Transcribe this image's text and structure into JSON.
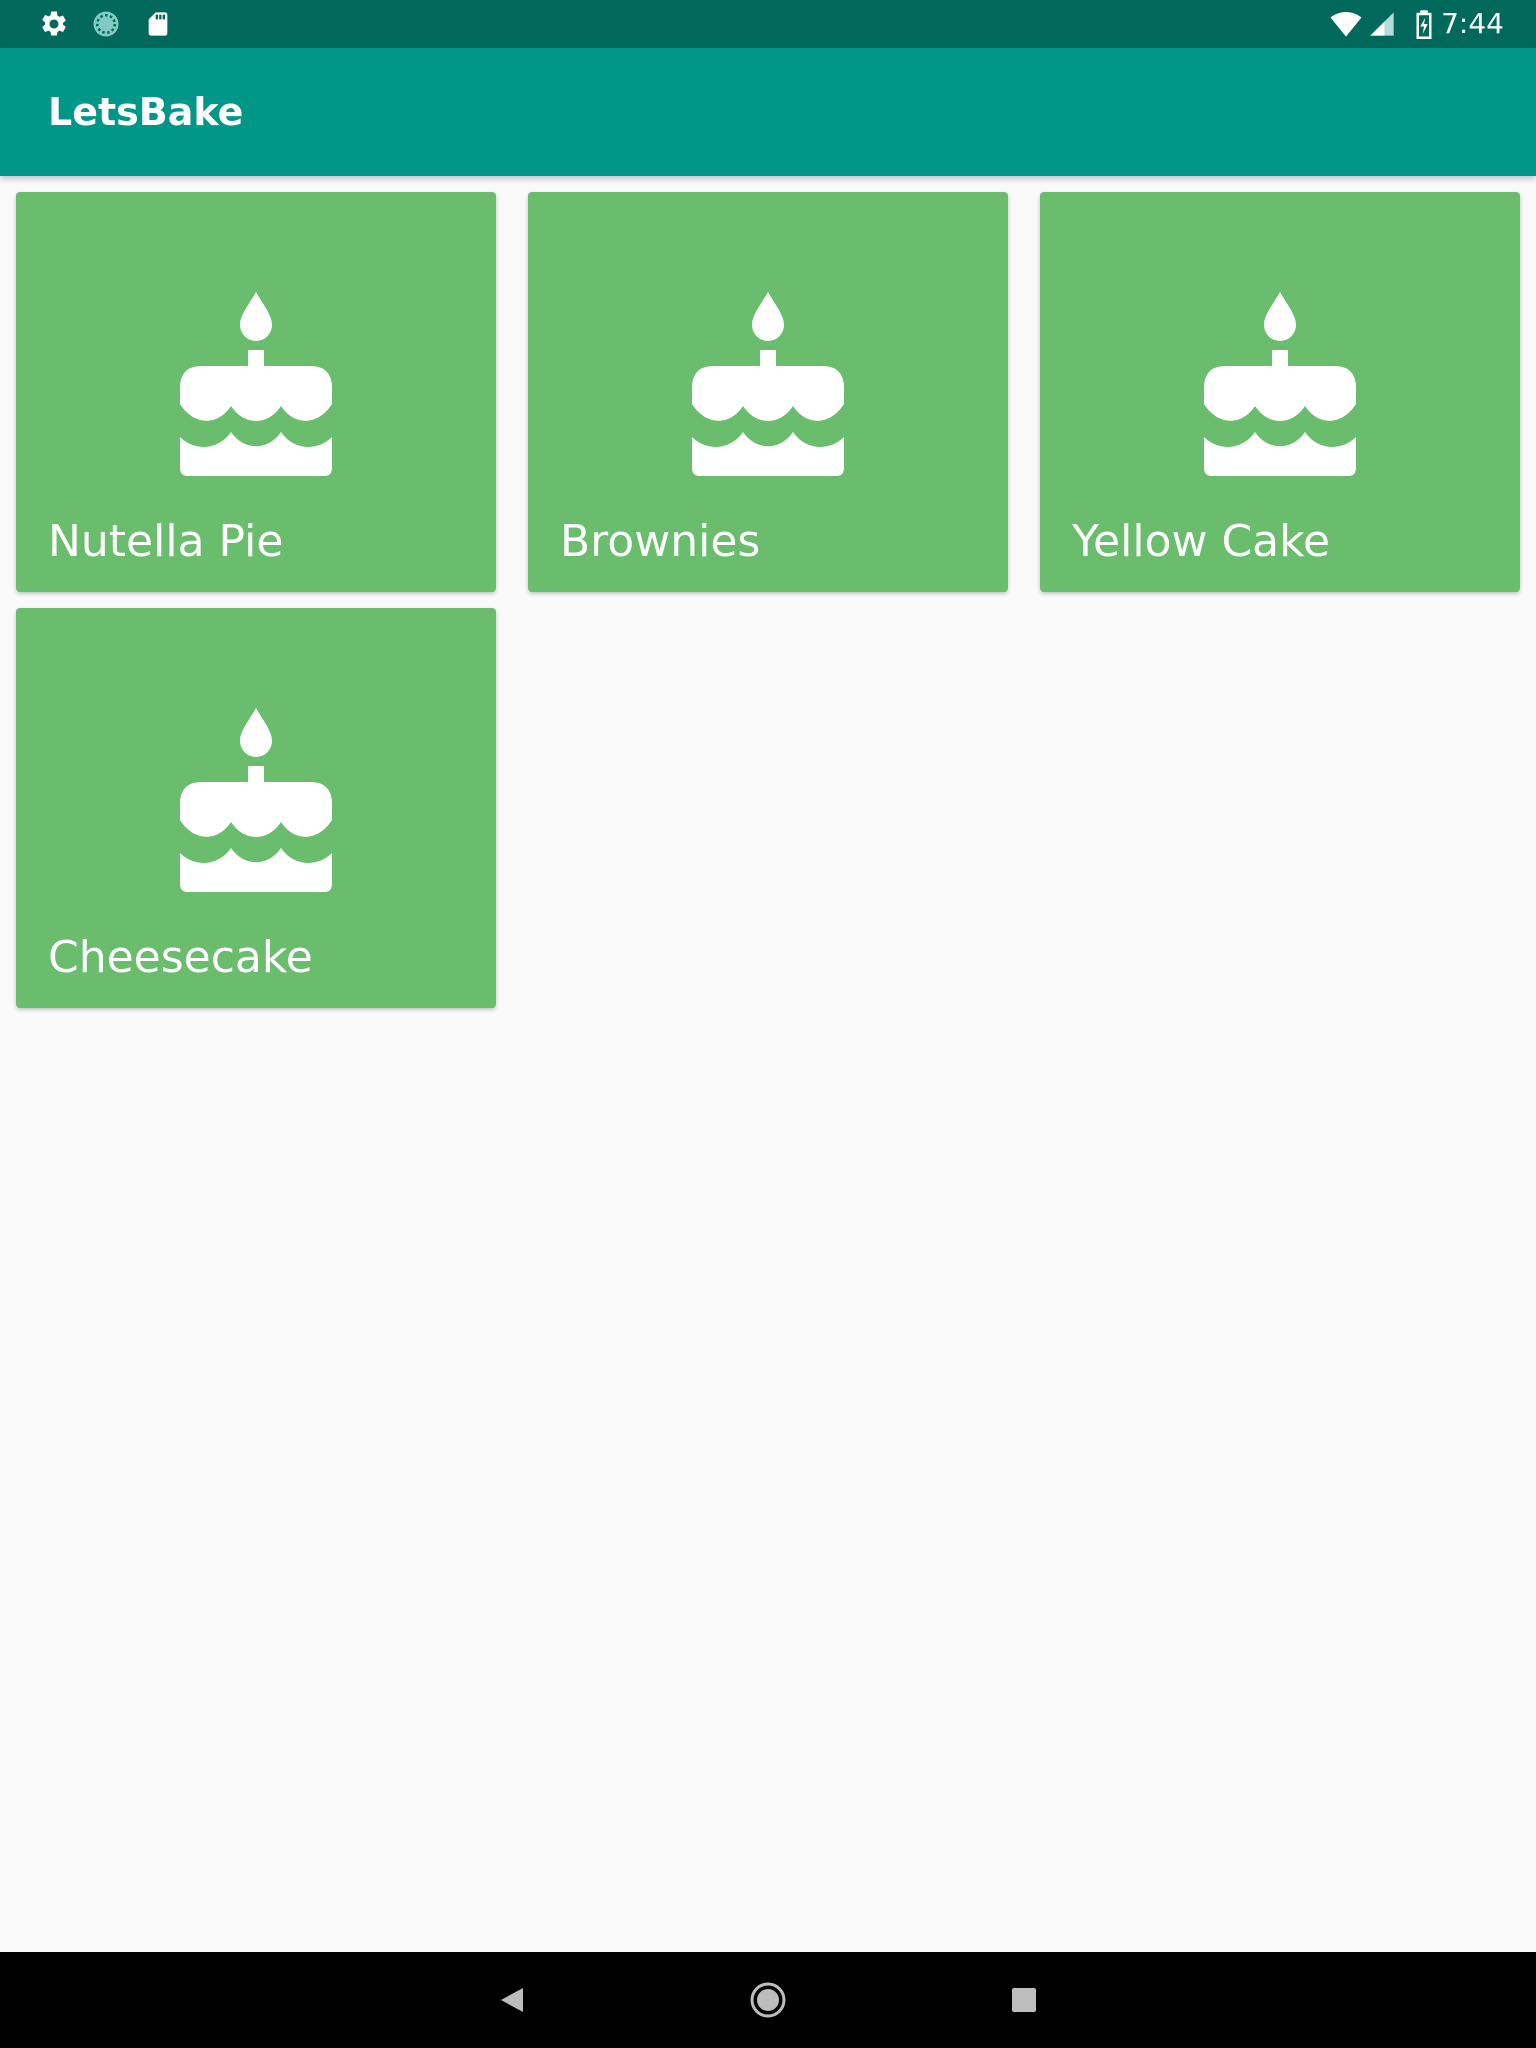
{
  "status_bar": {
    "time": "7:44",
    "left_icons": [
      "settings-icon",
      "sync-icon",
      "sd-card-icon"
    ],
    "right_icons": [
      "wifi-icon",
      "cell-signal-icon",
      "battery-charging-icon"
    ]
  },
  "app_bar": {
    "title": "LetsBake"
  },
  "recipes": [
    {
      "name": "Nutella Pie",
      "icon": "cake-icon"
    },
    {
      "name": "Brownies",
      "icon": "cake-icon"
    },
    {
      "name": "Yellow Cake",
      "icon": "cake-icon"
    },
    {
      "name": "Cheesecake",
      "icon": "cake-icon"
    }
  ],
  "nav_bar": {
    "buttons": [
      "back-icon",
      "home-icon",
      "recents-icon"
    ]
  },
  "colors": {
    "status_bar": "#00695c",
    "app_bar": "#009688",
    "card": "#69bd6d",
    "background": "#fafafa",
    "nav_bar": "#000000"
  }
}
